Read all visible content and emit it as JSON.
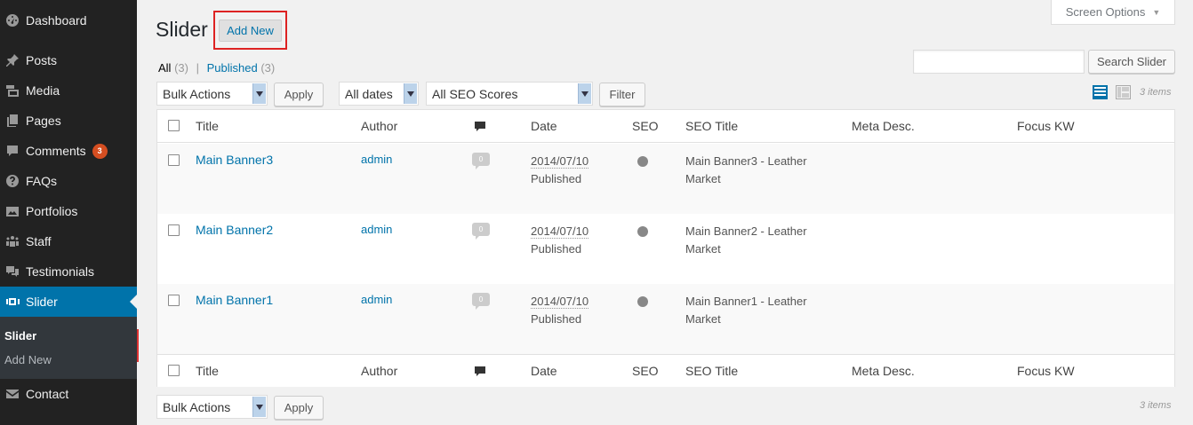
{
  "sidebar": {
    "items": [
      {
        "label": "Dashboard",
        "icon": "dashboard-icon"
      },
      {
        "label": "Posts",
        "icon": "pin-icon"
      },
      {
        "label": "Media",
        "icon": "media-icon"
      },
      {
        "label": "Pages",
        "icon": "pages-icon"
      },
      {
        "label": "Comments",
        "icon": "comments-icon",
        "badge": "3"
      },
      {
        "label": "FAQs",
        "icon": "help-icon"
      },
      {
        "label": "Portfolios",
        "icon": "portfolio-icon"
      },
      {
        "label": "Staff",
        "icon": "groups-icon"
      },
      {
        "label": "Testimonials",
        "icon": "testimonial-icon"
      },
      {
        "label": "Slider",
        "icon": "slides-icon",
        "current": true
      },
      {
        "label": "Contact",
        "icon": "email-icon"
      }
    ],
    "submenu": [
      {
        "label": "Slider",
        "active": true
      },
      {
        "label": "Add New"
      }
    ],
    "colors": {
      "bg": "#222222",
      "current": "#0073aa",
      "badge": "#d54e21"
    }
  },
  "header": {
    "title": "Slider",
    "add_new_label": "Add New",
    "screen_options_label": "Screen Options"
  },
  "views": {
    "all_label": "All",
    "all_count": "(3)",
    "separator": "|",
    "published_label": "Published",
    "published_count": "(3)"
  },
  "search": {
    "placeholder": "",
    "button_label": "Search Slider"
  },
  "tablenav_top": {
    "bulk_actions": "Bulk Actions",
    "apply_label": "Apply",
    "dates_filter": "All dates",
    "seo_filter": "All SEO Scores",
    "filter_label": "Filter",
    "items_count": "3 items"
  },
  "tablenav_bottom": {
    "bulk_actions": "Bulk Actions",
    "apply_label": "Apply",
    "items_count": "3 items"
  },
  "table": {
    "columns": {
      "title": "Title",
      "author": "Author",
      "date": "Date",
      "seo": "SEO",
      "seo_title": "SEO Title",
      "meta_desc": "Meta Desc.",
      "focus_kw": "Focus KW"
    },
    "rows": [
      {
        "title": "Main Banner3",
        "author": "admin",
        "comments": "0",
        "date": "2014/07/10",
        "status": "Published",
        "seo_title": "Main Banner3 - Leather Market",
        "meta_desc": "",
        "focus_kw": ""
      },
      {
        "title": "Main Banner2",
        "author": "admin",
        "comments": "0",
        "date": "2014/07/10",
        "status": "Published",
        "seo_title": "Main Banner2 - Leather Market",
        "meta_desc": "",
        "focus_kw": ""
      },
      {
        "title": "Main Banner1",
        "author": "admin",
        "comments": "0",
        "date": "2014/07/10",
        "status": "Published",
        "seo_title": "Main Banner1 - Leather Market",
        "meta_desc": "",
        "focus_kw": ""
      }
    ]
  },
  "accent_colors": {
    "link": "#0073aa",
    "highlight": "#dd2222"
  }
}
